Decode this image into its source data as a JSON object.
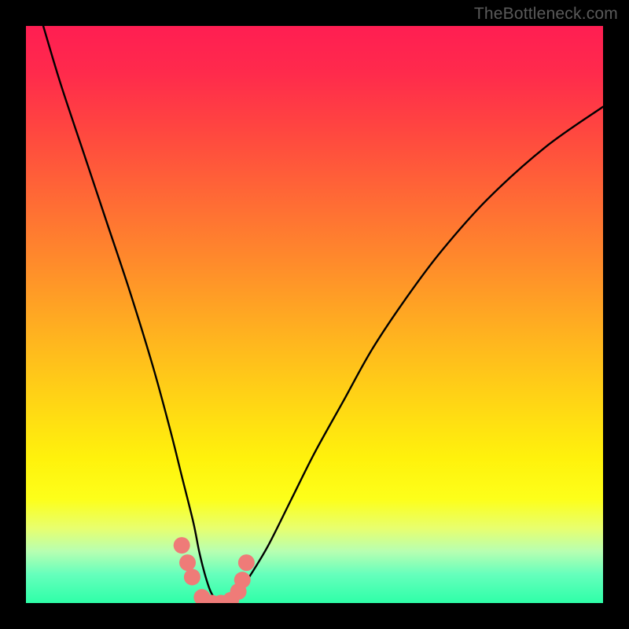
{
  "watermark": "TheBottleneck.com",
  "chart_data": {
    "type": "line",
    "title": "",
    "xlabel": "",
    "ylabel": "",
    "xlim": [
      0,
      100
    ],
    "ylim": [
      0,
      100
    ],
    "grid": false,
    "legend": false,
    "series": [
      {
        "name": "main-curve",
        "color": "#000000",
        "x": [
          3,
          6,
          10,
          14,
          18,
          22,
          25,
          27,
          29,
          30,
          31,
          32,
          33,
          34,
          35,
          36,
          37,
          39,
          42,
          46,
          50,
          55,
          60,
          66,
          72,
          80,
          90,
          100
        ],
        "y": [
          100,
          90,
          78,
          66,
          54,
          41,
          30,
          22,
          14,
          9,
          5,
          2,
          0.5,
          0,
          0,
          0.5,
          2,
          5,
          10,
          18,
          26,
          35,
          44,
          53,
          61,
          70,
          79,
          86
        ]
      },
      {
        "name": "highlight-dots",
        "color": "#ef7b78",
        "x": [
          27,
          28,
          28.8,
          30.5,
          32.2,
          33.8,
          35.5,
          36.8,
          37.5,
          38.2
        ],
        "y": [
          10,
          7,
          4.5,
          1,
          0,
          0,
          0.5,
          2,
          4,
          7
        ]
      }
    ],
    "background_gradient": {
      "direction": "vertical",
      "stops": [
        {
          "pos": 0,
          "color": "#ff1e52"
        },
        {
          "pos": 50,
          "color": "#ffc21a"
        },
        {
          "pos": 80,
          "color": "#fdff1a"
        },
        {
          "pos": 100,
          "color": "#2effa8"
        }
      ]
    }
  }
}
